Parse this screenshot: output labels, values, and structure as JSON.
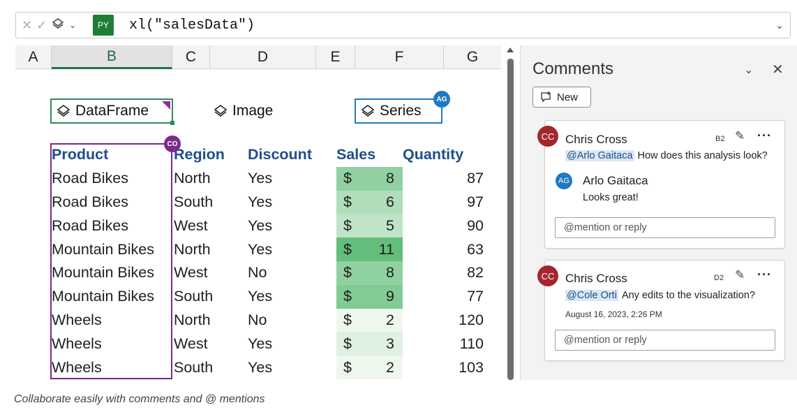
{
  "formula_bar": {
    "cancel_icon": "x-icon",
    "enter_icon": "check-icon",
    "python_output_icon": "diamond-stack-icon",
    "badge": "PY",
    "formula": "xl(\"salesData\")"
  },
  "columns": [
    "A",
    "B",
    "C",
    "D",
    "E",
    "F",
    "G"
  ],
  "selected_column": "B",
  "python_objects": {
    "dataframe": "DataFrame",
    "image": "Image",
    "series": "Series"
  },
  "presence": {
    "series_user": "AG",
    "product_user": "CO"
  },
  "table": {
    "headers": {
      "product": "Product",
      "region": "Region",
      "discount": "Discount",
      "sales": "Sales",
      "quantity": "Quantity"
    },
    "currency": "$",
    "rows": [
      {
        "product": "Road Bikes",
        "region": "North",
        "discount": "Yes",
        "sales": "8",
        "quantity": "87"
      },
      {
        "product": "Road Bikes",
        "region": "South",
        "discount": "Yes",
        "sales": "6",
        "quantity": "97"
      },
      {
        "product": "Road Bikes",
        "region": "West",
        "discount": "Yes",
        "sales": "5",
        "quantity": "90"
      },
      {
        "product": "Mountain Bikes",
        "region": "North",
        "discount": "Yes",
        "sales": "11",
        "quantity": "63"
      },
      {
        "product": "Mountain Bikes",
        "region": "West",
        "discount": "No",
        "sales": "8",
        "quantity": "82"
      },
      {
        "product": "Mountain Bikes",
        "region": "South",
        "discount": "Yes",
        "sales": "9",
        "quantity": "77"
      },
      {
        "product": "Wheels",
        "region": "North",
        "discount": "No",
        "sales": "2",
        "quantity": "120"
      },
      {
        "product": "Wheels",
        "region": "West",
        "discount": "Yes",
        "sales": "3",
        "quantity": "110"
      },
      {
        "product": "Wheels",
        "region": "South",
        "discount": "Yes",
        "sales": "2",
        "quantity": "103"
      }
    ],
    "sales_scale_colors": {
      "low": "#eef7ee",
      "high": "#63be7b"
    }
  },
  "comments_pane": {
    "title": "Comments",
    "new_label": "New",
    "threads": [
      {
        "avatar": "CC",
        "author": "Chris Cross",
        "cell": "B2",
        "mention": "@Arlo Gaitaca",
        "text": "How does this analysis look?",
        "reply": {
          "avatar": "AG",
          "author": "Arlo Gaitaca",
          "text": "Looks great!"
        },
        "reply_placeholder": "@mention or reply"
      },
      {
        "avatar": "CC",
        "author": "Chris Cross",
        "cell": "D2",
        "mention": "@Cole Orti",
        "text": "Any edits to the visualization?",
        "timestamp": "August 16, 2023, 2:26 PM",
        "reply_placeholder": "@mention or reply"
      }
    ]
  },
  "caption": "Collaborate easily with comments and @ mentions"
}
